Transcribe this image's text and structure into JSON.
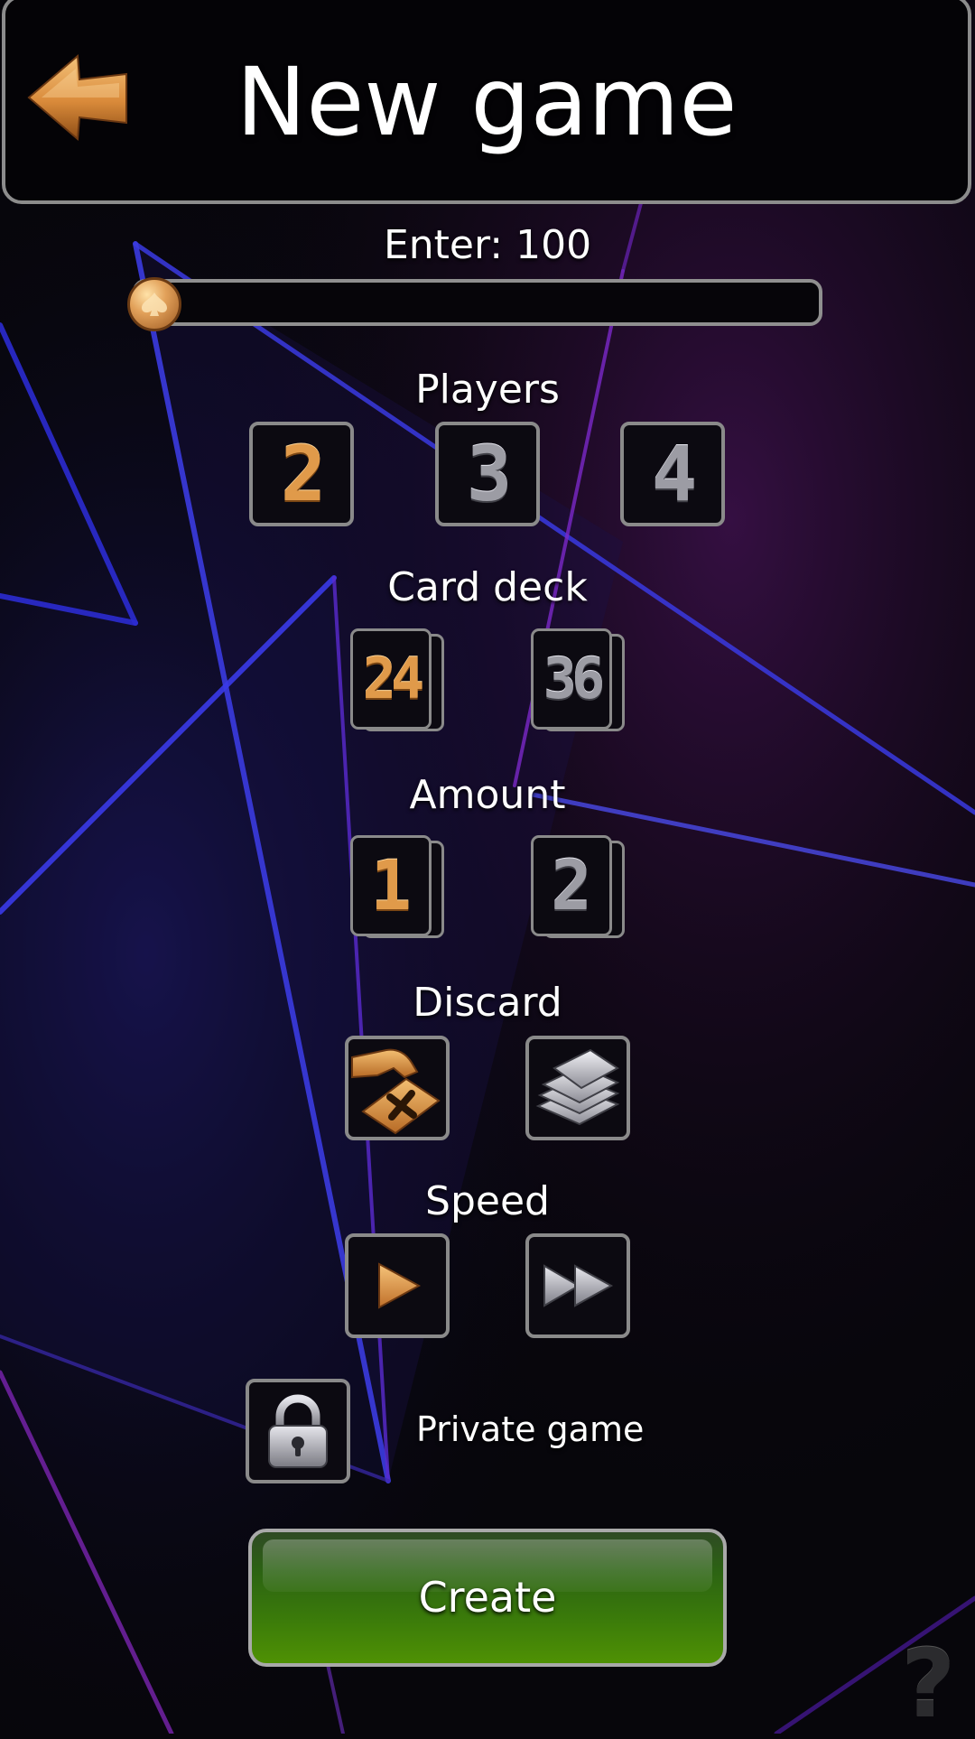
{
  "header": {
    "title": "New game",
    "back_icon": "arrow-left-icon"
  },
  "bet": {
    "label": "Enter: 100",
    "value": 100,
    "level": 0
  },
  "players": {
    "label": "Players",
    "options": [
      "2",
      "3",
      "4"
    ],
    "selected": "2"
  },
  "card_deck": {
    "label": "Card deck",
    "options": [
      "24",
      "36"
    ],
    "selected": "24"
  },
  "amount": {
    "label": "Amount",
    "options": [
      "1",
      "2"
    ],
    "selected": "1"
  },
  "discard": {
    "label": "Discard",
    "options": [
      "hand-discard-icon",
      "card-stack-icon"
    ],
    "selected": "hand-discard-icon"
  },
  "speed": {
    "label": "Speed",
    "options": [
      "play-icon",
      "fast-forward-icon"
    ],
    "selected": "play-icon"
  },
  "private_game": {
    "label": "Private game",
    "icon": "lock-icon"
  },
  "create_button": {
    "label": "Create"
  },
  "help": {
    "label": "?"
  },
  "colors": {
    "gold": "#e09a4a",
    "grey": "#9c9ca4",
    "button_green": "#3a7a0a",
    "border": "#8a8a8a"
  }
}
